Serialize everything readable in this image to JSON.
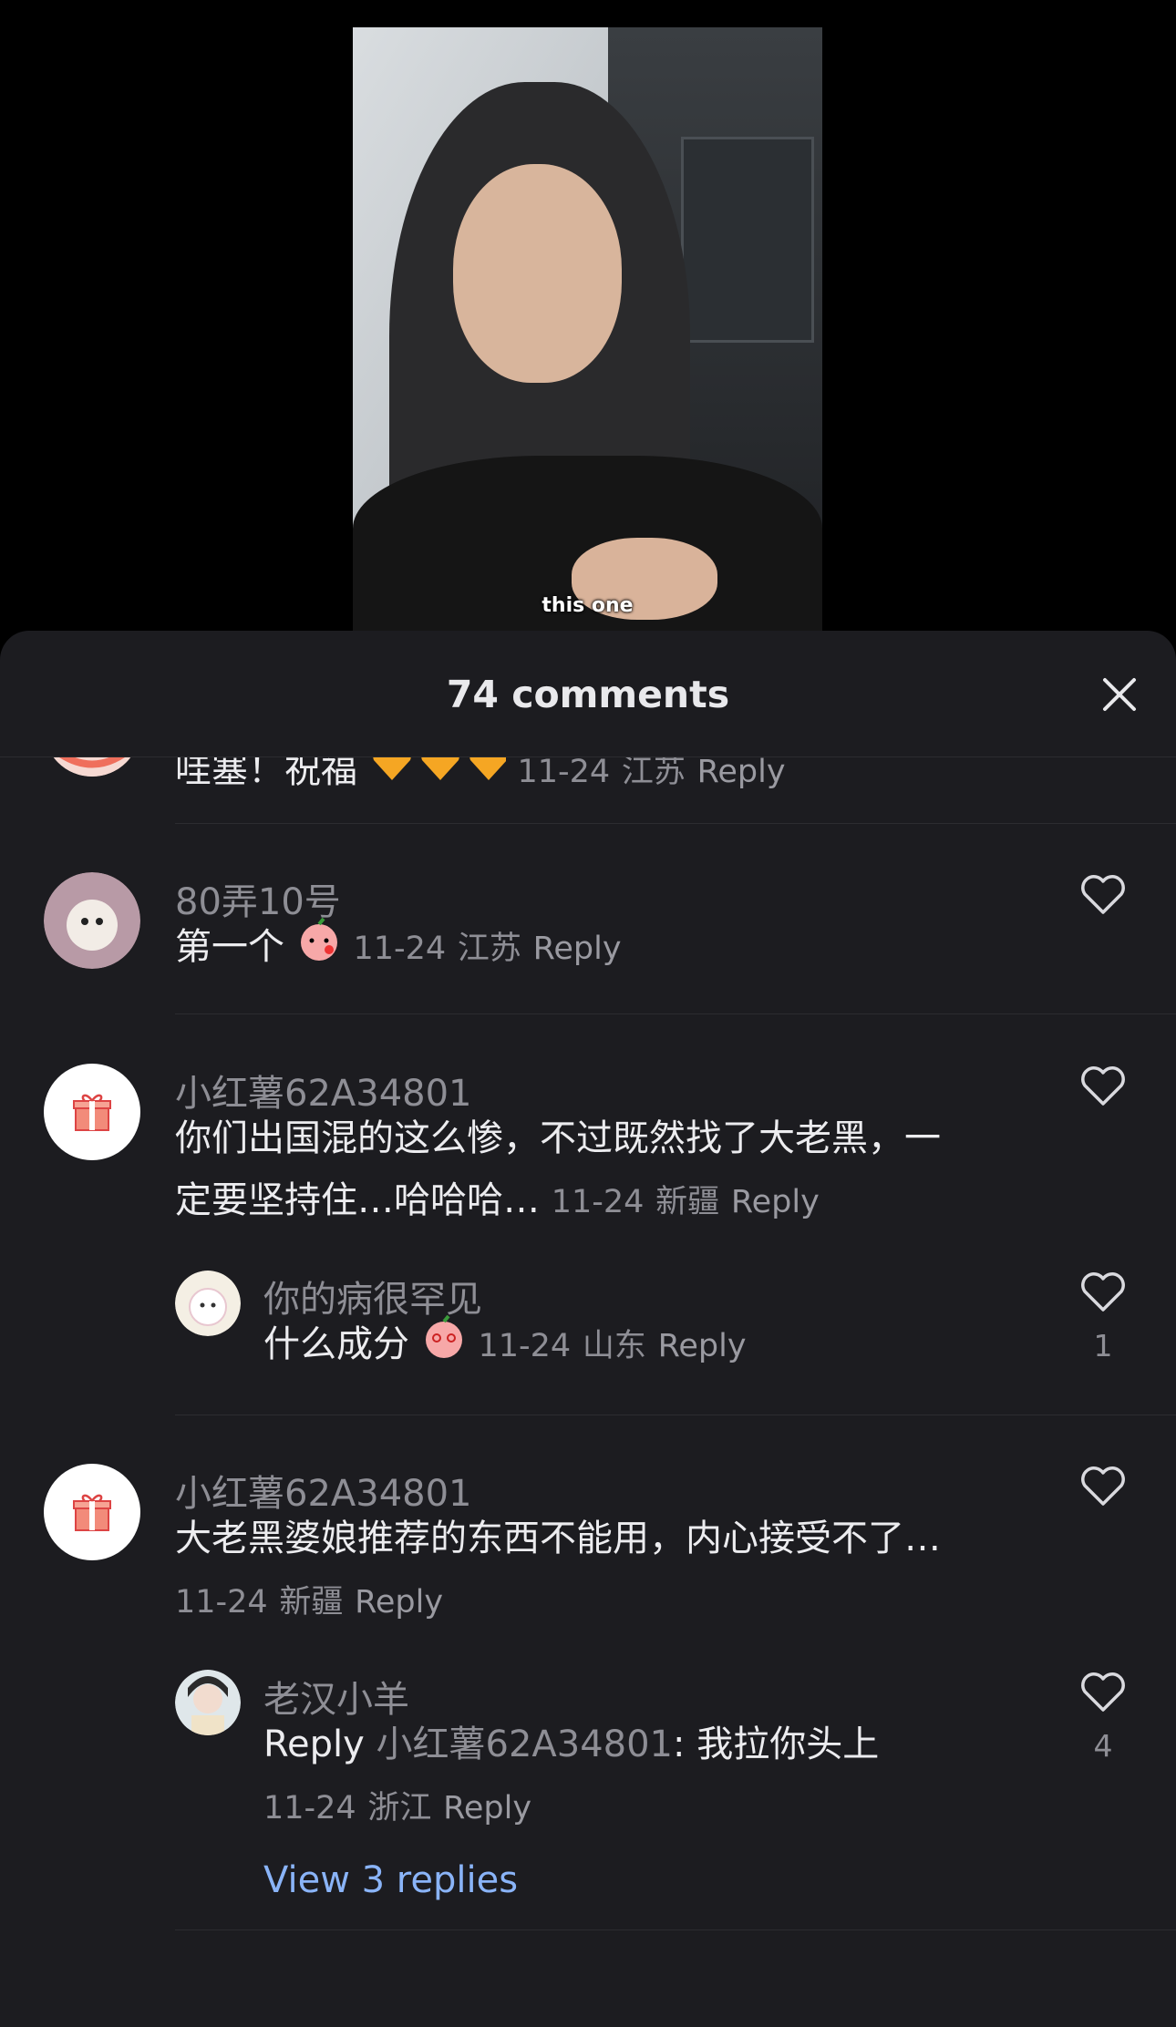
{
  "video": {
    "caption": "this one"
  },
  "sheet": {
    "title": "74 comments"
  },
  "comments": [
    {
      "text": "哇塞！祝福",
      "date": "11-24",
      "location": "江苏",
      "reply": "Reply"
    },
    {
      "username": "80弄10号",
      "text": "第一个",
      "date": "11-24",
      "location": "江苏",
      "reply": "Reply"
    },
    {
      "username": "小红薯62A34801",
      "text_line1": "你们出国混的这么惨，不过既然找了大老黑，一",
      "text_line2": "定要坚持住…哈哈哈…",
      "date": "11-24",
      "location": "新疆",
      "reply": "Reply",
      "replies": [
        {
          "username": "你的病很罕见",
          "text": "什么成分",
          "date": "11-24",
          "location": "山东",
          "reply": "Reply",
          "likes": "1"
        }
      ]
    },
    {
      "username": "小红薯62A34801",
      "text": "大老黑婆娘推荐的东西不能用，内心接受不了…",
      "date": "11-24",
      "location": "新疆",
      "reply": "Reply",
      "replies": [
        {
          "username": "老汉小羊",
          "reply_prefix": "Reply",
          "reply_to": "小红薯62A34801",
          "text": ": 我拉你头上",
          "date": "11-24",
          "location": "浙江",
          "reply": "Reply",
          "likes": "4"
        }
      ],
      "view_replies": "View 3 replies"
    }
  ],
  "colors": {
    "sheet_bg": "#1c1c20",
    "muted_text": "#8e8e95",
    "link_blue": "#8ab4f8"
  }
}
